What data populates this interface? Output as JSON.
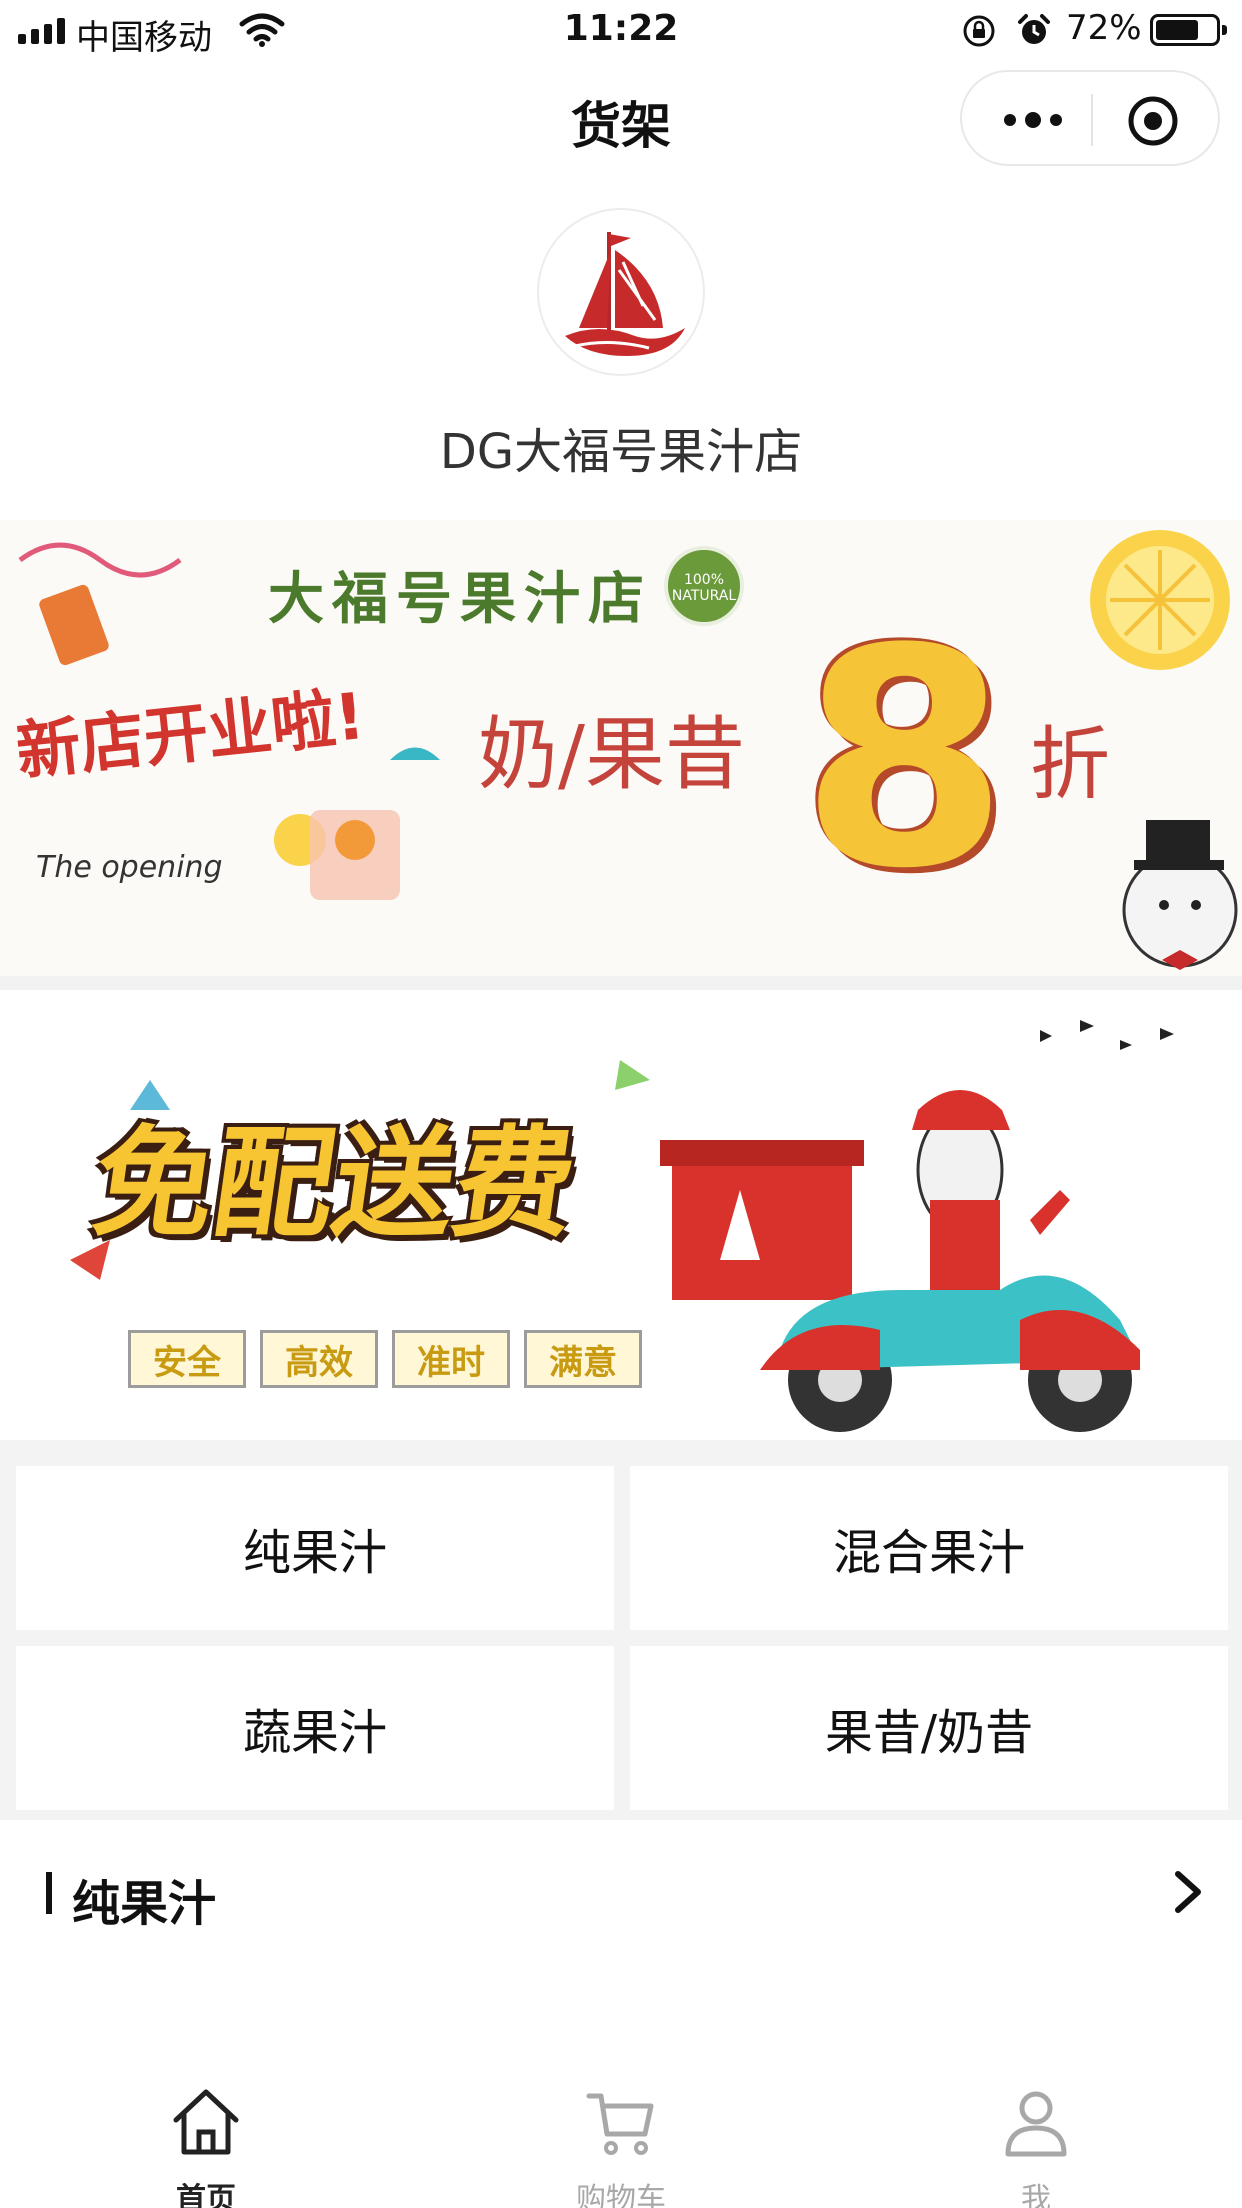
{
  "status_bar": {
    "carrier": "中国移动",
    "time": "11:22",
    "battery_percent": "72%",
    "battery_level": 0.72,
    "icons": [
      "signal-icon",
      "wifi-icon",
      "rotation-lock-icon",
      "alarm-icon",
      "battery-icon"
    ]
  },
  "nav": {
    "title": "货架",
    "capsule_icons": [
      "more-icon",
      "close-target-icon"
    ]
  },
  "store": {
    "name": "DG大福号果汁店",
    "logo_icon": "sailboat-logo"
  },
  "banners": [
    {
      "shop_name": "大福号果汁店",
      "badge": "100% NATURAL",
      "promo_text": "奶/果昔",
      "promo_number": "8",
      "promo_suffix": "折",
      "headline": "新店开业啦!",
      "subline": "The opening"
    },
    {
      "title": "免配送费",
      "tags": [
        "安全",
        "高效",
        "准时",
        "满意"
      ]
    }
  ],
  "categories": [
    {
      "label": "纯果汁"
    },
    {
      "label": "混合果汁"
    },
    {
      "label": "蔬果汁"
    },
    {
      "label": "果昔/奶昔"
    }
  ],
  "section": {
    "title": "纯果汁"
  },
  "tab_bar": {
    "tabs": [
      {
        "label": "首页",
        "icon": "home-icon",
        "active": true
      },
      {
        "label": "购物车",
        "icon": "cart-icon",
        "active": false
      },
      {
        "label": "我",
        "icon": "user-icon",
        "active": false
      }
    ]
  },
  "colors": {
    "brand_red": "#c62a2a",
    "active_tab": "#222222",
    "inactive_tab": "#a8a8a8",
    "page_bg": "#f3f3f3"
  }
}
